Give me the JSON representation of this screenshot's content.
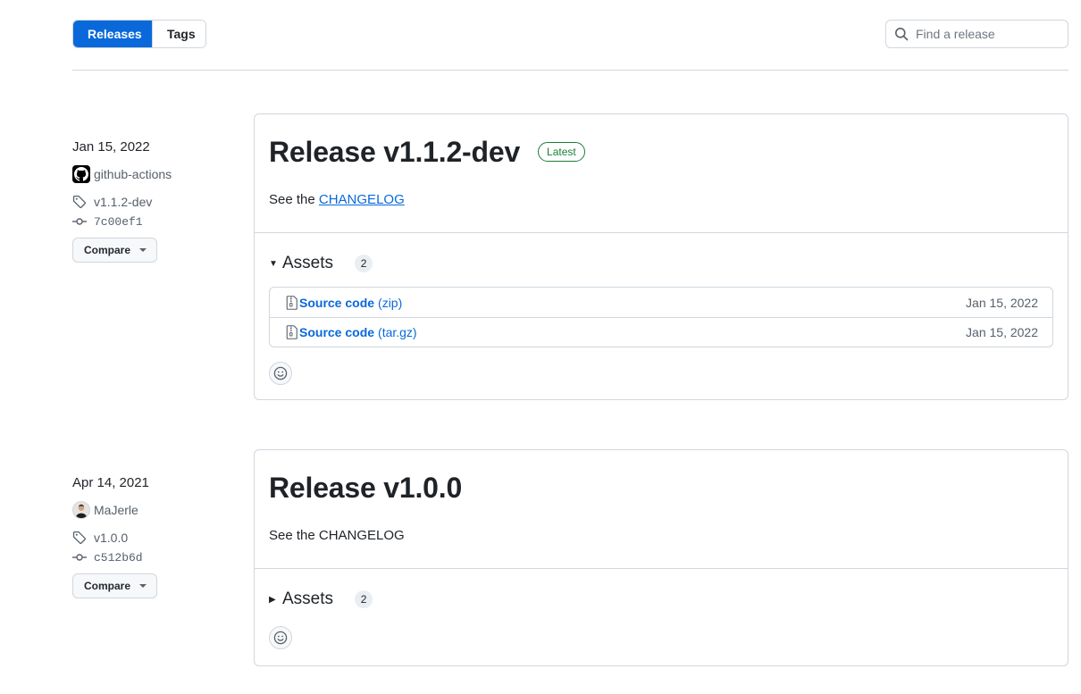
{
  "tabs": [
    {
      "label": "Releases",
      "active": true
    },
    {
      "label": "Tags",
      "active": false
    }
  ],
  "search": {
    "placeholder": "Find a release",
    "value": ""
  },
  "colors": {
    "accent": "#0969da",
    "latest_badge": "#1a7f37",
    "border": "#d0d7de"
  },
  "releases": [
    {
      "date": "Jan 15, 2022",
      "author": "github-actions",
      "author_avatar": "github-logo",
      "tag": "v1.1.2-dev",
      "commit": "7c00ef1",
      "compare_label": "Compare",
      "title": "Release v1.1.2-dev",
      "badge": "Latest",
      "body_prefix": "See the",
      "body_link": "CHANGELOG",
      "assets_label": "Assets",
      "assets_count": "2",
      "assets_expanded": true,
      "assets": [
        {
          "name": "Source code",
          "ext": "(zip)",
          "date": "Jan 15, 2022"
        },
        {
          "name": "Source code",
          "ext": "(tar.gz)",
          "date": "Jan 15, 2022"
        }
      ]
    },
    {
      "date": "Apr 14, 2021",
      "author": "MaJerle",
      "author_avatar": "user-photo",
      "tag": "v1.0.0",
      "commit": "c512b6d",
      "compare_label": "Compare",
      "title": "Release v1.0.0",
      "body": "See the CHANGELOG",
      "assets_label": "Assets",
      "assets_count": "2",
      "assets_expanded": false
    }
  ]
}
